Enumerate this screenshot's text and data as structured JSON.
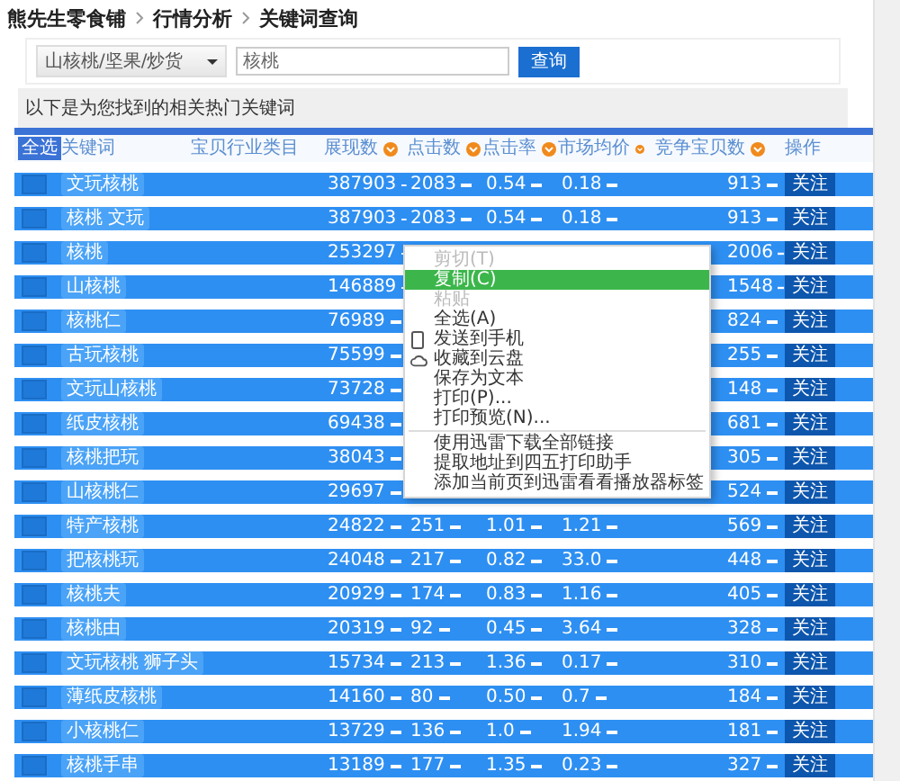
{
  "breadcrumb": [
    "熊先生零食铺",
    "行情分析",
    "关键词查询"
  ],
  "filter": {
    "category": "山核桃/坚果/炒货",
    "keyword": "核桃",
    "button": "查询"
  },
  "caption": "以下是为您找到的相关热门关键词",
  "table": {
    "select_all": "全选",
    "columns": [
      {
        "label": "关键词",
        "sortable": false
      },
      {
        "label": "宝贝行业类目",
        "sortable": false
      },
      {
        "label": "展现数",
        "sortable": true
      },
      {
        "label": "点击数",
        "sortable": true
      },
      {
        "label": "点击率",
        "sortable": true
      },
      {
        "label": "市场均价",
        "sortable": true
      },
      {
        "label": "竞争宝贝数",
        "sortable": true
      },
      {
        "label": "操作",
        "sortable": false
      }
    ],
    "rows": [
      {
        "checked": false,
        "keyword": "文玩核桃",
        "impressions": "387903",
        "clicks": "2083",
        "ctr": "0.54",
        "price": "0.18",
        "competitors": "913",
        "action": "关注"
      },
      {
        "checked": false,
        "keyword": "核桃 文玩",
        "impressions": "387903",
        "clicks": "2083",
        "ctr": "0.54",
        "price": "0.18",
        "competitors": "913",
        "action": "关注"
      },
      {
        "checked": false,
        "keyword": "核桃",
        "impressions": "253297",
        "competitors": "2006",
        "action": "关注"
      },
      {
        "checked": false,
        "keyword": "山核桃",
        "impressions": "146889",
        "competitors": "1548",
        "action": "关注"
      },
      {
        "checked": false,
        "keyword": "核桃仁",
        "impressions": "76989",
        "competitors": "824",
        "action": "关注"
      },
      {
        "checked": false,
        "keyword": "古玩核桃",
        "impressions": "75599",
        "competitors": "255",
        "action": "关注"
      },
      {
        "checked": false,
        "keyword": "文玩山核桃",
        "impressions": "73728",
        "competitors": "148",
        "action": "关注"
      },
      {
        "checked": false,
        "keyword": "纸皮核桃",
        "impressions": "69438",
        "competitors": "681",
        "action": "关注"
      },
      {
        "checked": false,
        "keyword": "核桃把玩",
        "impressions": "38043",
        "competitors": "305",
        "action": "关注"
      },
      {
        "checked": false,
        "keyword": "山核桃仁",
        "impressions": "29697",
        "competitors": "524",
        "action": "关注"
      },
      {
        "checked": false,
        "keyword": "特产核桃",
        "impressions": "24822",
        "clicks": "251",
        "ctr": "1.01",
        "price": "1.21",
        "competitors": "569",
        "action": "关注"
      },
      {
        "checked": false,
        "keyword": "把核桃玩",
        "impressions": "24048",
        "clicks": "217",
        "ctr": "0.82",
        "price": "33.0",
        "competitors": "448",
        "action": "关注"
      },
      {
        "checked": false,
        "keyword": "核桃夫",
        "impressions": "20929",
        "clicks": "174",
        "ctr": "0.83",
        "price": "1.16",
        "competitors": "405",
        "action": "关注"
      },
      {
        "checked": false,
        "keyword": "核桃由",
        "impressions": "20319",
        "clicks": "92",
        "ctr": "0.45",
        "price": "3.64",
        "competitors": "328",
        "action": "关注"
      },
      {
        "checked": false,
        "keyword": "文玩核桃 狮子头",
        "impressions": "15734",
        "clicks": "213",
        "ctr": "1.36",
        "price": "0.17",
        "competitors": "310",
        "action": "关注"
      },
      {
        "checked": false,
        "keyword": "薄纸皮核桃",
        "impressions": "14160",
        "clicks": "80",
        "ctr": "0.50",
        "price": "0.7",
        "competitors": "184",
        "action": "关注"
      },
      {
        "checked": false,
        "keyword": "小核桃仁",
        "impressions": "13729",
        "clicks": "136",
        "ctr": "1.0",
        "price": "1.94",
        "competitors": "181",
        "action": "关注"
      },
      {
        "checked": false,
        "keyword": "核桃手串",
        "impressions": "13189",
        "clicks": "177",
        "ctr": "1.35",
        "price": "0.23",
        "competitors": "327",
        "action": "关注"
      }
    ]
  },
  "context_menu": {
    "groups": [
      [
        {
          "kind": "text",
          "label": "剪切(T)",
          "disabled": true,
          "selected": false
        },
        {
          "kind": "text",
          "label": "复制(C)",
          "disabled": false,
          "selected": true
        },
        {
          "kind": "text",
          "label": "粘贴",
          "disabled": true,
          "selected": false
        },
        {
          "kind": "text",
          "label": "全选(A)",
          "disabled": false,
          "selected": false
        },
        {
          "kind": "phone",
          "label": "发送到手机",
          "disabled": false,
          "selected": false
        },
        {
          "kind": "cloud",
          "label": "收藏到云盘",
          "disabled": false,
          "selected": false
        },
        {
          "kind": "text",
          "label": "保存为文本",
          "disabled": false,
          "selected": false
        },
        {
          "kind": "text",
          "label": "打印(P)...",
          "disabled": false,
          "selected": false
        },
        {
          "kind": "text",
          "label": "打印预览(N)...",
          "disabled": false,
          "selected": false
        }
      ],
      [
        {
          "kind": "text",
          "label": "使用迅雷下载全部链接",
          "disabled": false,
          "selected": false
        },
        {
          "kind": "text",
          "label": "提取地址到四五打印助手",
          "disabled": false,
          "selected": false
        },
        {
          "kind": "text",
          "label": "添加当前页到迅雷看看播放器标签",
          "disabled": false,
          "selected": false
        }
      ]
    ]
  }
}
